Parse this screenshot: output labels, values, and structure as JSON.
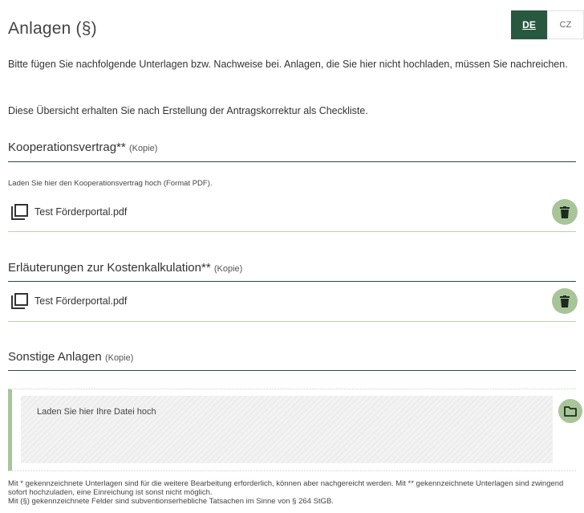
{
  "header": {
    "title": "Anlagen (§)",
    "lang_de": "DE",
    "lang_cz": "CZ"
  },
  "intro": {
    "line1": "Bitte fügen Sie nachfolgende Unterlagen bzw. Nachweise bei. Anlagen, die Sie hier nicht hochladen, müssen Sie nachreichen.",
    "line2": "Diese Übersicht erhalten Sie nach Erstellung der Antragskorrektur als Checkliste."
  },
  "sections": [
    {
      "title": "Kooperationsvertrag**",
      "suffix": "(Kopie)",
      "hint": "Laden Sie hier den Kooperationsvertrag hoch (Format PDF).",
      "file_name": "Test Förderportal.pdf"
    },
    {
      "title": "Erläuterungen zur Kostenkalkulation**",
      "suffix": "(Kopie)",
      "file_name": "Test Förderportal.pdf"
    },
    {
      "title": "Sonstige Anlagen",
      "suffix": "(Kopie)",
      "upload_label": "Laden Sie hier Ihre Datei hoch"
    }
  ],
  "footnotes": {
    "line1": "Mit * gekennzeichnete Unterlagen sind für die weitere Bearbeitung erforderlich, können aber nachgereicht werden. Mit ** gekennzeichnete Unterlagen sind zwingend sofort hochzuladen, eine Einreichung ist sonst nicht möglich.",
    "line2": "Mit (§) gekennzeichnete Felder sind subventionserhebliche Tatsachen im Sinne von § 264 StGB."
  },
  "icons": {
    "file": "file-copy-icon",
    "delete": "trash-icon",
    "upload": "folder-icon"
  },
  "colors": {
    "brand_green": "#295841",
    "accent_green": "#a8c599",
    "divider_dark": "#2e4a3d"
  }
}
